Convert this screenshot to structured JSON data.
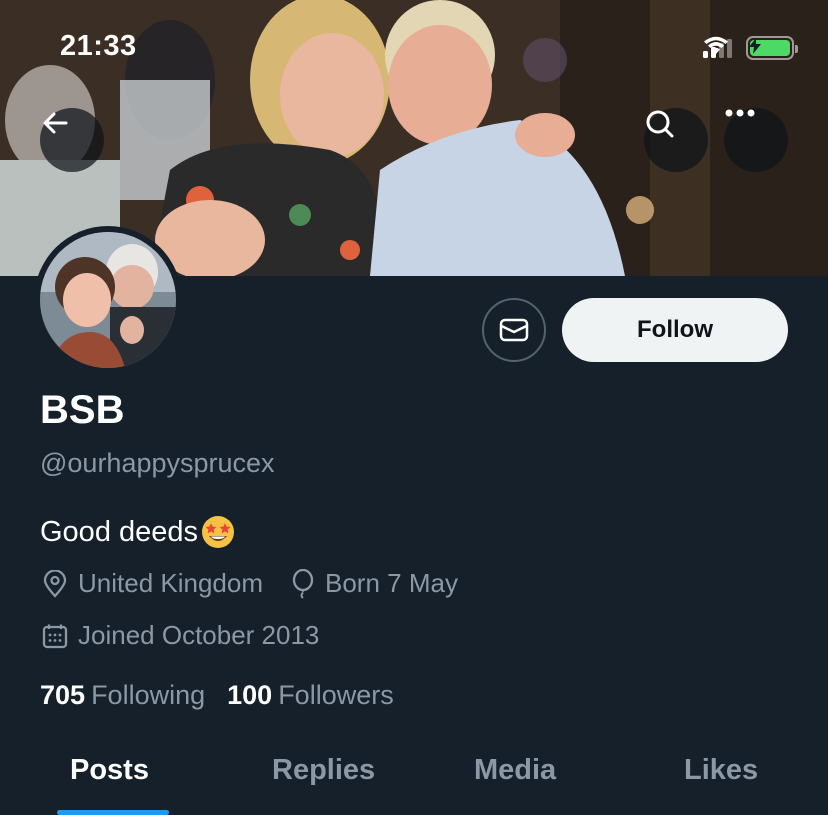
{
  "status_bar": {
    "time": "21:33",
    "icons": [
      "cellular-signal-icon",
      "wifi-icon",
      "battery-charging-icon"
    ],
    "battery_color": "#4cd964"
  },
  "banner": {
    "back_icon": "arrow-left-icon",
    "search_icon": "search-icon",
    "more_icon": "more-horizontal-icon"
  },
  "profile": {
    "display_name": "BSB",
    "handle": "@ourhappysprucex",
    "bio": "Good deeds",
    "bio_emoji": "star-struck-emoji",
    "location": "United Kingdom",
    "birthday": "Born 7 May",
    "joined": "Joined October 2013",
    "following_count": "705",
    "following_label": "Following",
    "followers_count": "100",
    "followers_label": "Followers"
  },
  "actions": {
    "message_icon": "envelope-icon",
    "follow_label": "Follow"
  },
  "tabs": [
    {
      "label": "Posts",
      "active": true
    },
    {
      "label": "Replies",
      "active": false
    },
    {
      "label": "Media",
      "active": false
    },
    {
      "label": "Likes",
      "active": false
    }
  ],
  "colors": {
    "background": "#15202b",
    "secondary_text": "#8b98a5",
    "accent": "#1d9bf0",
    "follow_button": "#eff3f4"
  }
}
